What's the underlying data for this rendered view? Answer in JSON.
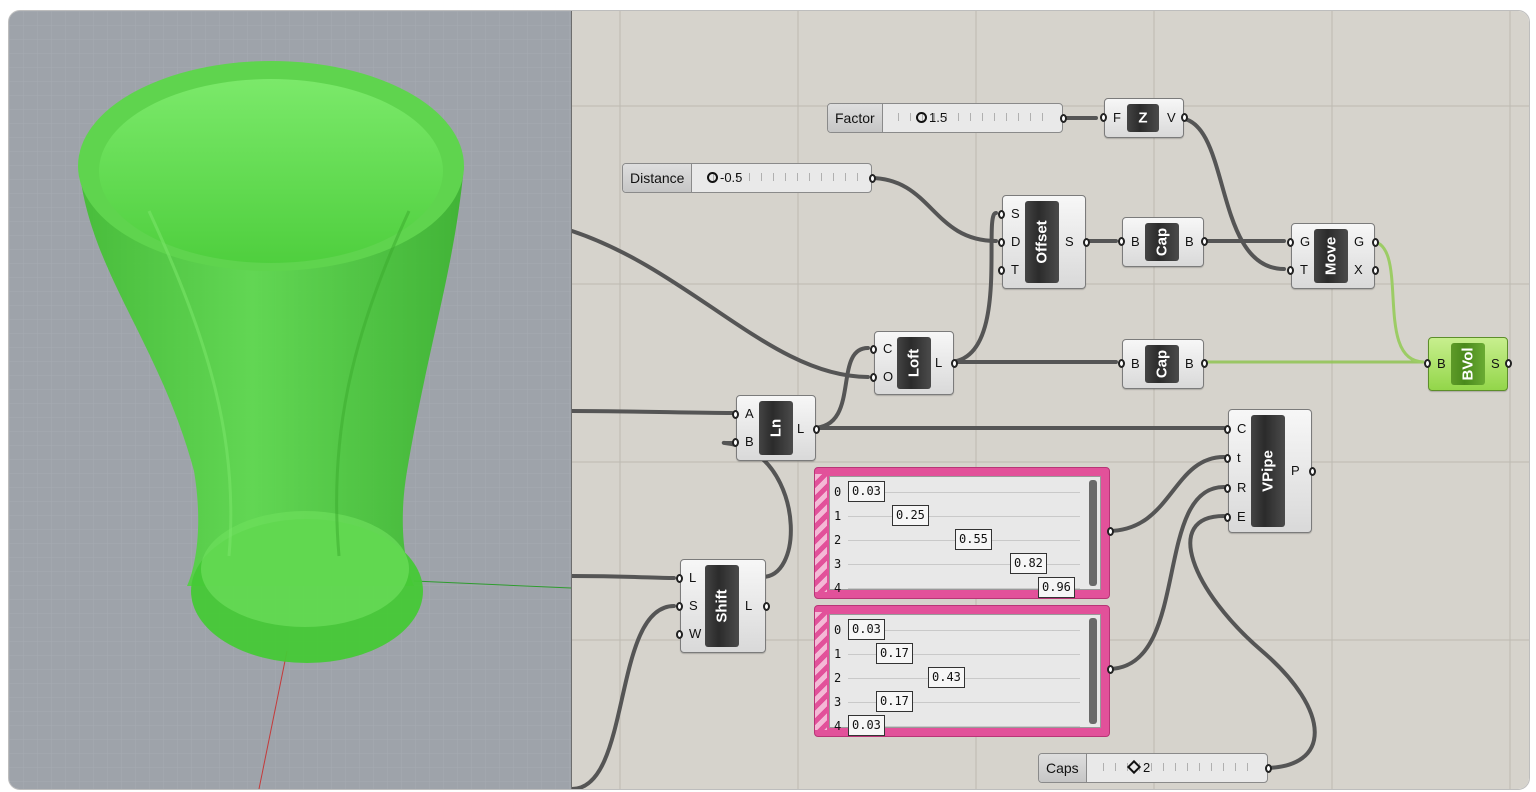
{
  "colors": {
    "canvas_bg": "#d6d3cc",
    "viewport_bg": "#9aa0a8",
    "mesh_green": "#4fd13f",
    "panel_pink": "#e2519a",
    "wire_dark": "#555555",
    "wire_green": "#8bc34a"
  },
  "components": {
    "factor_slider": {
      "name": "Factor",
      "value": "1.5"
    },
    "distance_slider": {
      "name": "Distance",
      "value": "-0.5"
    },
    "caps_slider": {
      "name": "Caps",
      "value": "2"
    },
    "unit_z": {
      "title": "Z",
      "in": [
        "F"
      ],
      "out": [
        "V"
      ]
    },
    "offset": {
      "title": "Offset",
      "in": [
        "S",
        "D",
        "T"
      ],
      "out": [
        "S"
      ]
    },
    "cap_top": {
      "title": "Cap",
      "in": [
        "B"
      ],
      "out": [
        "B"
      ]
    },
    "move": {
      "title": "Move",
      "in": [
        "G",
        "T"
      ],
      "out": [
        "G",
        "X"
      ]
    },
    "loft": {
      "title": "Loft",
      "in": [
        "C",
        "O"
      ],
      "out": [
        "L"
      ]
    },
    "cap_mid": {
      "title": "Cap",
      "in": [
        "B"
      ],
      "out": [
        "B"
      ]
    },
    "bvol": {
      "title": "BVol",
      "in": [
        "B"
      ],
      "out": [
        "S"
      ]
    },
    "line": {
      "title": "Ln",
      "in": [
        "A",
        "B"
      ],
      "out": [
        "L"
      ]
    },
    "vpipe": {
      "title": "VPipe",
      "in": [
        "C",
        "t",
        "R",
        "E"
      ],
      "out": [
        "P"
      ]
    },
    "shift": {
      "title": "Shift",
      "in": [
        "L",
        "S",
        "W"
      ],
      "out": [
        "L"
      ]
    }
  },
  "panel_t": {
    "rows": [
      {
        "i": "0",
        "v": "0.03"
      },
      {
        "i": "1",
        "v": "0.25"
      },
      {
        "i": "2",
        "v": "0.55"
      },
      {
        "i": "3",
        "v": "0.82"
      },
      {
        "i": "4",
        "v": "0.96"
      }
    ]
  },
  "panel_r": {
    "rows": [
      {
        "i": "0",
        "v": "0.03"
      },
      {
        "i": "1",
        "v": "0.17"
      },
      {
        "i": "2",
        "v": "0.43"
      },
      {
        "i": "3",
        "v": "0.17"
      },
      {
        "i": "4",
        "v": "0.03"
      }
    ]
  }
}
